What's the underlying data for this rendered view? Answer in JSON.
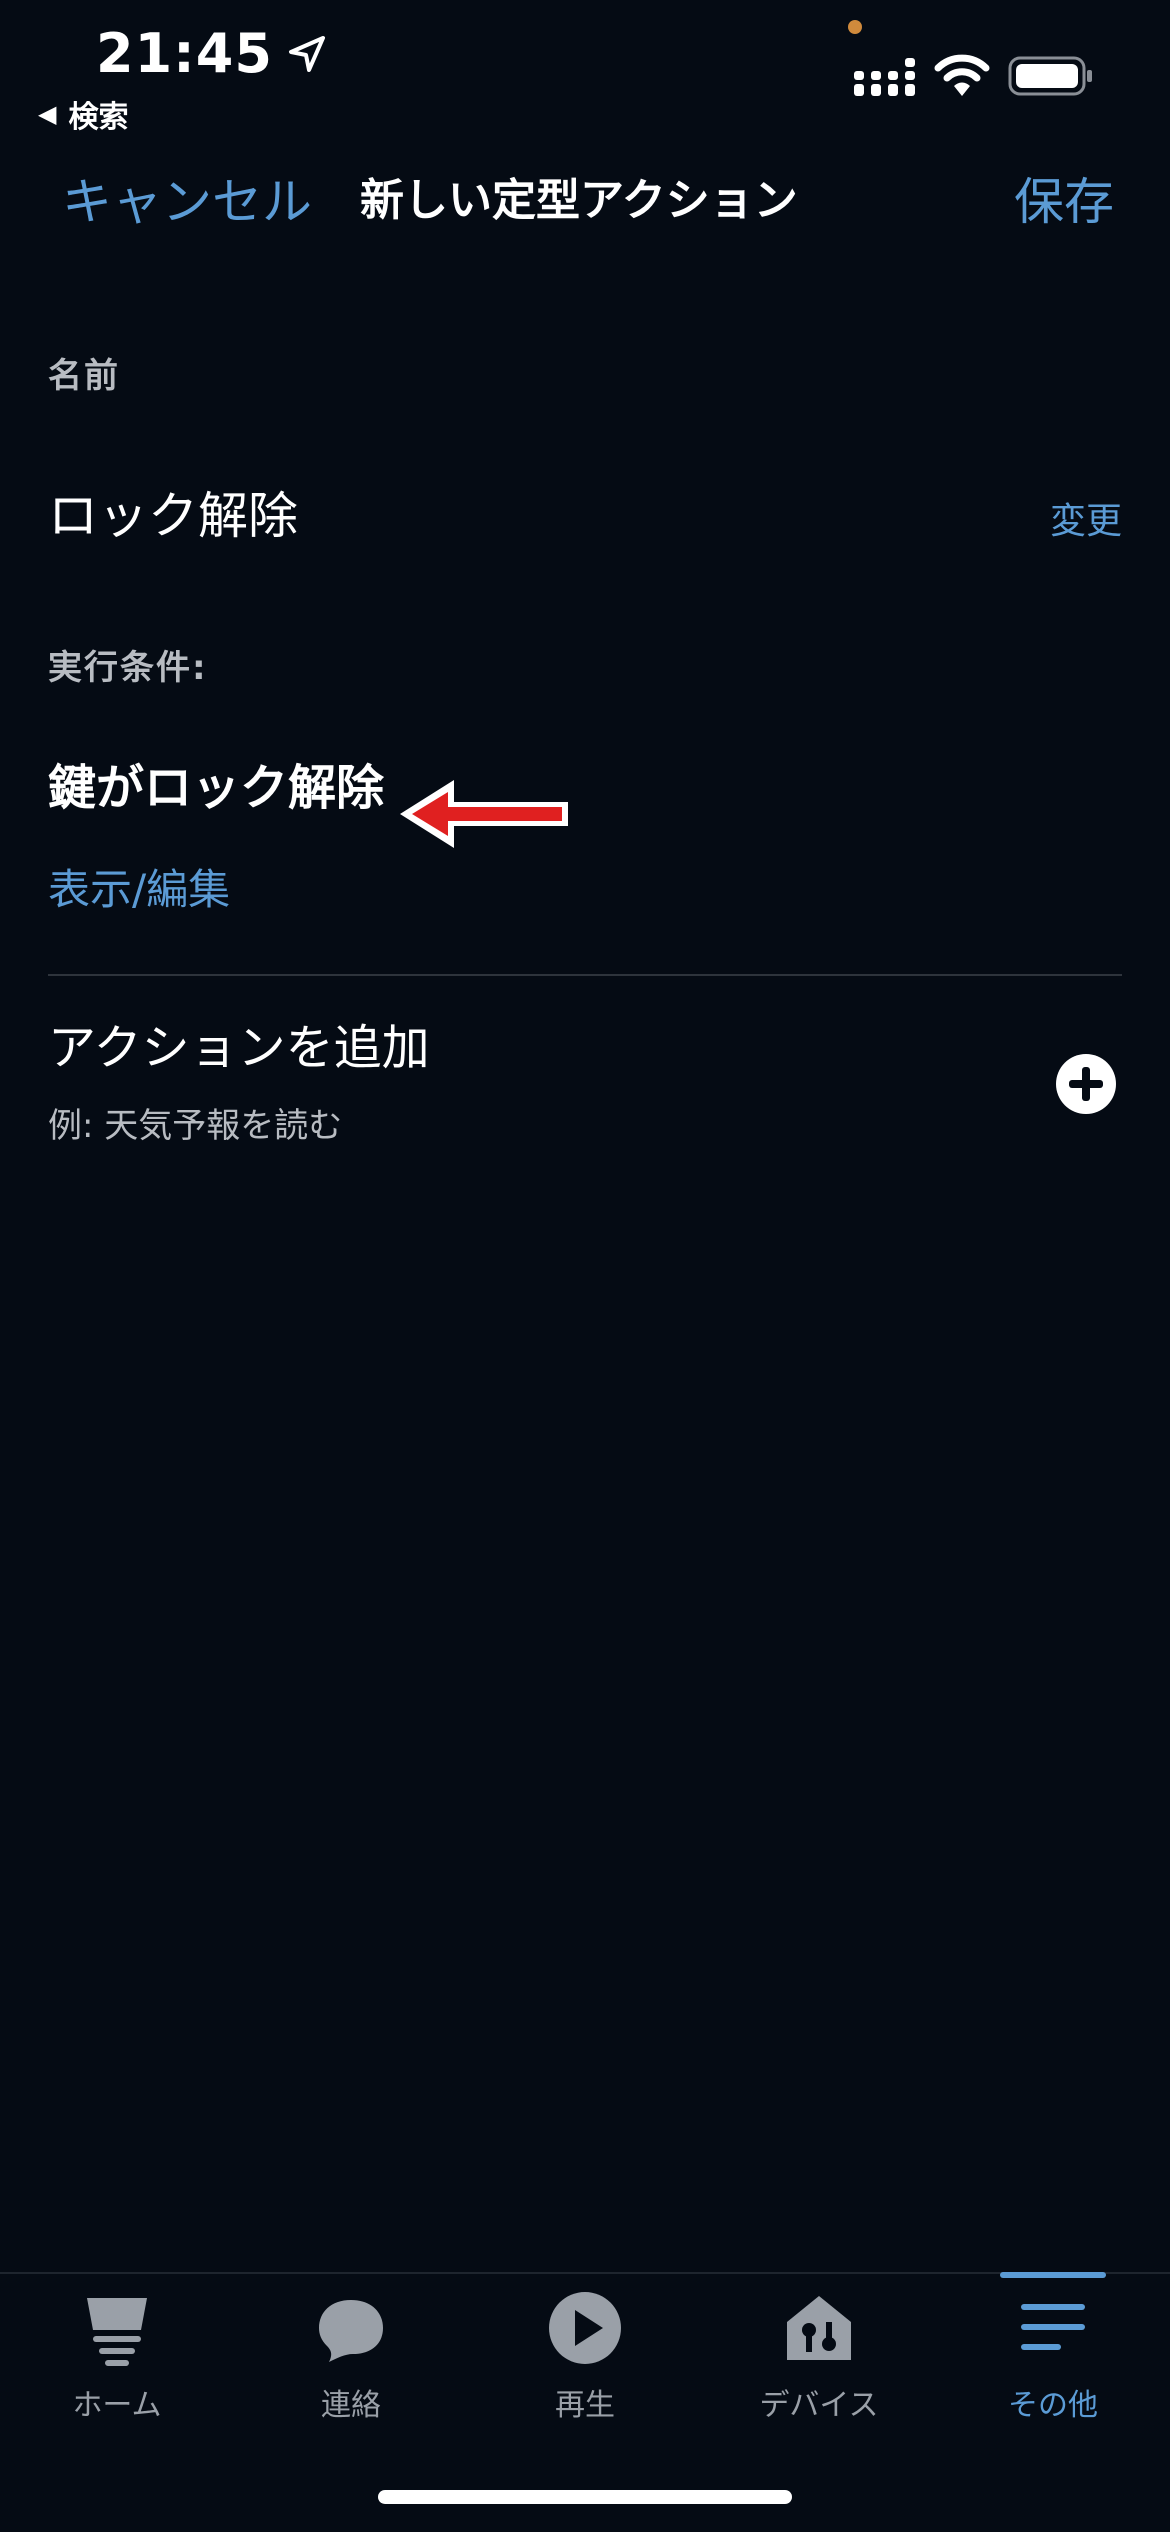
{
  "status_bar": {
    "time": "21:45",
    "back_app": "検索"
  },
  "nav": {
    "cancel": "キャンセル",
    "title": "新しい定型アクション",
    "save": "保存"
  },
  "name_section": {
    "label": "名前",
    "value": "ロック解除",
    "change": "変更"
  },
  "trigger_section": {
    "label": "実行条件:",
    "title": "鍵がロック解除",
    "edit": "表示/編集"
  },
  "action_section": {
    "title": "アクションを追加",
    "example": "例: 天気予報を読む"
  },
  "tabs": [
    {
      "label": "ホーム",
      "icon": "home-icon",
      "active": false
    },
    {
      "label": "連絡",
      "icon": "chat-icon",
      "active": false
    },
    {
      "label": "再生",
      "icon": "play-icon",
      "active": false
    },
    {
      "label": "デバイス",
      "icon": "devices-icon",
      "active": false
    },
    {
      "label": "その他",
      "icon": "menu-icon",
      "active": true
    }
  ],
  "colors": {
    "background": "#050b14",
    "accent": "#5b9bd5",
    "annotation_arrow": "#e02020"
  }
}
